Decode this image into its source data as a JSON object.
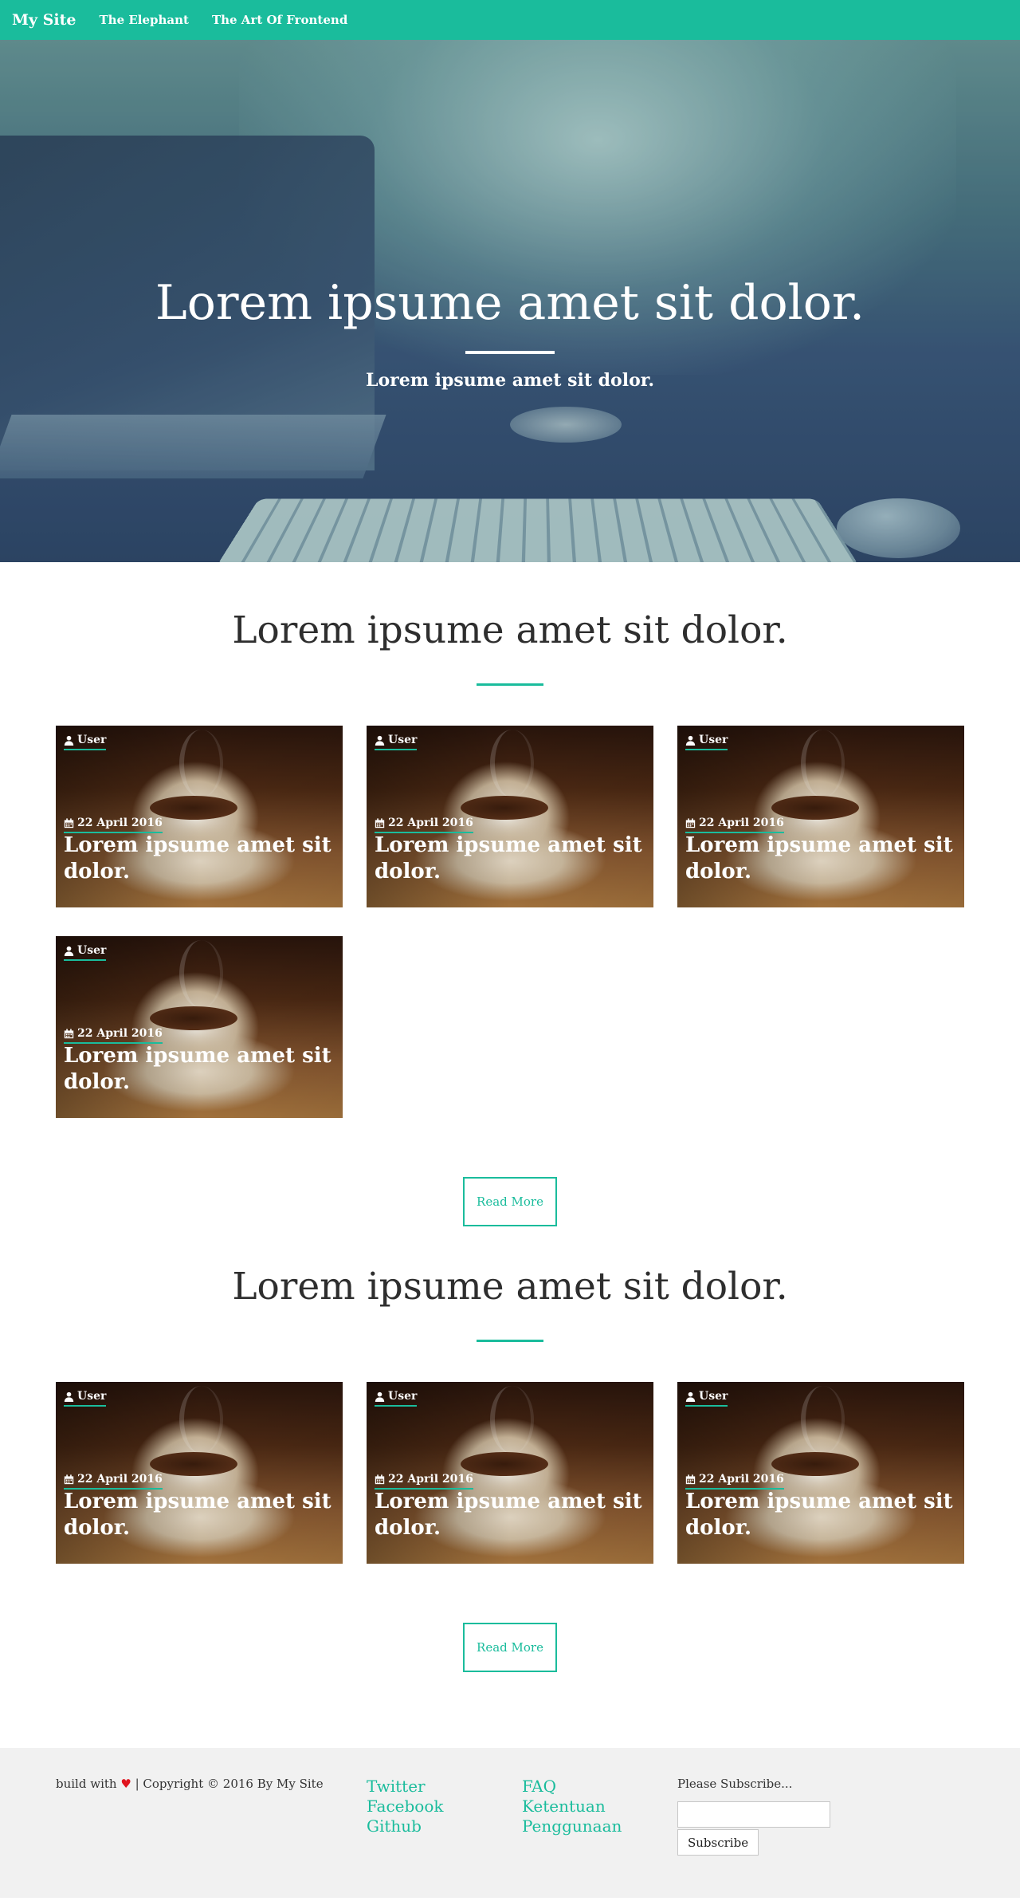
{
  "navbar": {
    "brand": "My Site",
    "links": [
      "The Elephant",
      "The Art Of Frontend"
    ]
  },
  "hero": {
    "title": "Lorem ipsume amet sit dolor.",
    "subtitle": "Lorem ipsume amet sit dolor."
  },
  "sections": [
    {
      "title": "Lorem ipsume amet sit dolor.",
      "cards": [
        {
          "user": "User",
          "date": "22 April 2016",
          "title": "Lorem ipsume amet sit dolor."
        },
        {
          "user": "User",
          "date": "22 April 2016",
          "title": "Lorem ipsume amet sit dolor."
        },
        {
          "user": "User",
          "date": "22 April 2016",
          "title": "Lorem ipsume amet sit dolor."
        },
        {
          "user": "User",
          "date": "22 April 2016",
          "title": "Lorem ipsume amet sit dolor."
        }
      ],
      "button": "Read More"
    },
    {
      "title": "Lorem ipsume amet sit dolor.",
      "cards": [
        {
          "user": "User",
          "date": "22 April 2016",
          "title": "Lorem ipsume amet sit dolor."
        },
        {
          "user": "User",
          "date": "22 April 2016",
          "title": "Lorem ipsume amet sit dolor."
        },
        {
          "user": "User",
          "date": "22 April 2016",
          "title": "Lorem ipsume amet sit dolor."
        }
      ],
      "button": "Read More"
    }
  ],
  "footer": {
    "build_with": "build with",
    "heart": "♥",
    "copyright": "| Copyright © 2016 By My Site",
    "social_links": [
      "Twitter",
      "Facebook",
      "Github"
    ],
    "info_links": [
      "FAQ",
      "Ketentuan",
      "Penggunaan"
    ],
    "subscribe_label": "Please Subscribe...",
    "subscribe_input_value": "",
    "subscribe_button": "Subscribe"
  },
  "colors": {
    "accent": "#1abc9c",
    "heart": "#e0141e",
    "footer_bg": "#f1f1f1"
  },
  "icons": {
    "user": "user-icon",
    "date": "calendar-icon",
    "heart": "heart-icon"
  }
}
